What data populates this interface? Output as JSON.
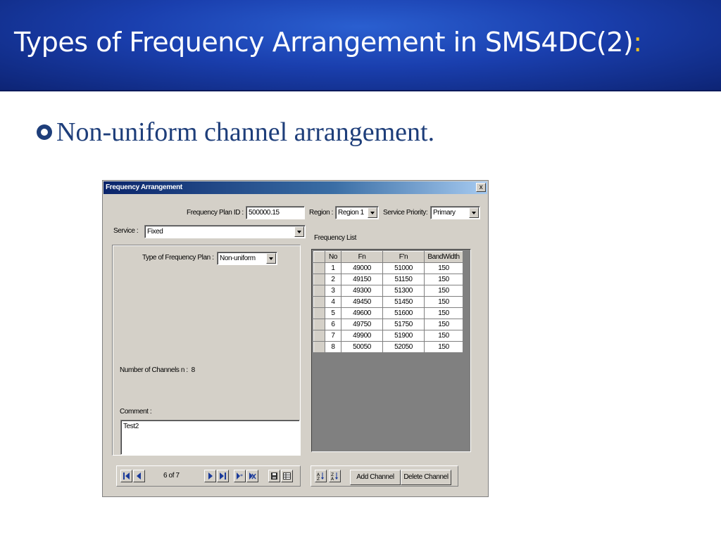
{
  "slide": {
    "title": "Types of Frequency Arrangement in SMS4DC(2)",
    "title_colon": ":",
    "bullet": "Non-uniform channel arrangement."
  },
  "dialog": {
    "title": "Frequency Arrangement",
    "close_label": "x",
    "plan_id_label": "Frequency Plan ID :",
    "plan_id_value": "500000.15",
    "region_label": "Region :",
    "region_value": "Region 1",
    "priority_label": "Service Priority:",
    "priority_value": "Primary",
    "service_label": "Service :",
    "service_value": "Fixed",
    "plan_type_label": "Type of Frequency Plan :",
    "plan_type_value": "Non-uniform",
    "channels_label": "Number of Channels  n :",
    "channels_value": "8",
    "comment_label": "Comment :",
    "comment_value": "Test2",
    "freq_list_label": "Frequency List",
    "nav_position": "6  of  7",
    "add_channel": "Add Channel",
    "delete_channel": "Delete Channel"
  },
  "frequency_table": {
    "headers": [
      "No",
      "Fn",
      "F'n",
      "BandWidth"
    ],
    "rows": [
      [
        "1",
        "49000",
        "51000",
        "150"
      ],
      [
        "2",
        "49150",
        "51150",
        "150"
      ],
      [
        "3",
        "49300",
        "51300",
        "150"
      ],
      [
        "4",
        "49450",
        "51450",
        "150"
      ],
      [
        "5",
        "49600",
        "51600",
        "150"
      ],
      [
        "6",
        "49750",
        "51750",
        "150"
      ],
      [
        "7",
        "49900",
        "51900",
        "150"
      ],
      [
        "8",
        "50050",
        "52050",
        "150"
      ]
    ]
  },
  "icons": {
    "bullet": "circle-bullet-icon",
    "nav": [
      "first-record-icon",
      "previous-record-icon",
      "next-record-icon",
      "last-record-icon",
      "new-record-icon",
      "delete-record-icon",
      "save-icon",
      "grid-view-icon",
      "sort-ascending-icon",
      "sort-descending-icon"
    ]
  },
  "colors": {
    "banner": "#1a3fae",
    "title_text": "#ffffff",
    "title_colon": "#f0c020",
    "bullet_text": "#1e3e7a",
    "dialog_face": "#d4d0c8",
    "titlebar": "#0a246a",
    "nav_icon": "#1a3a9a"
  }
}
